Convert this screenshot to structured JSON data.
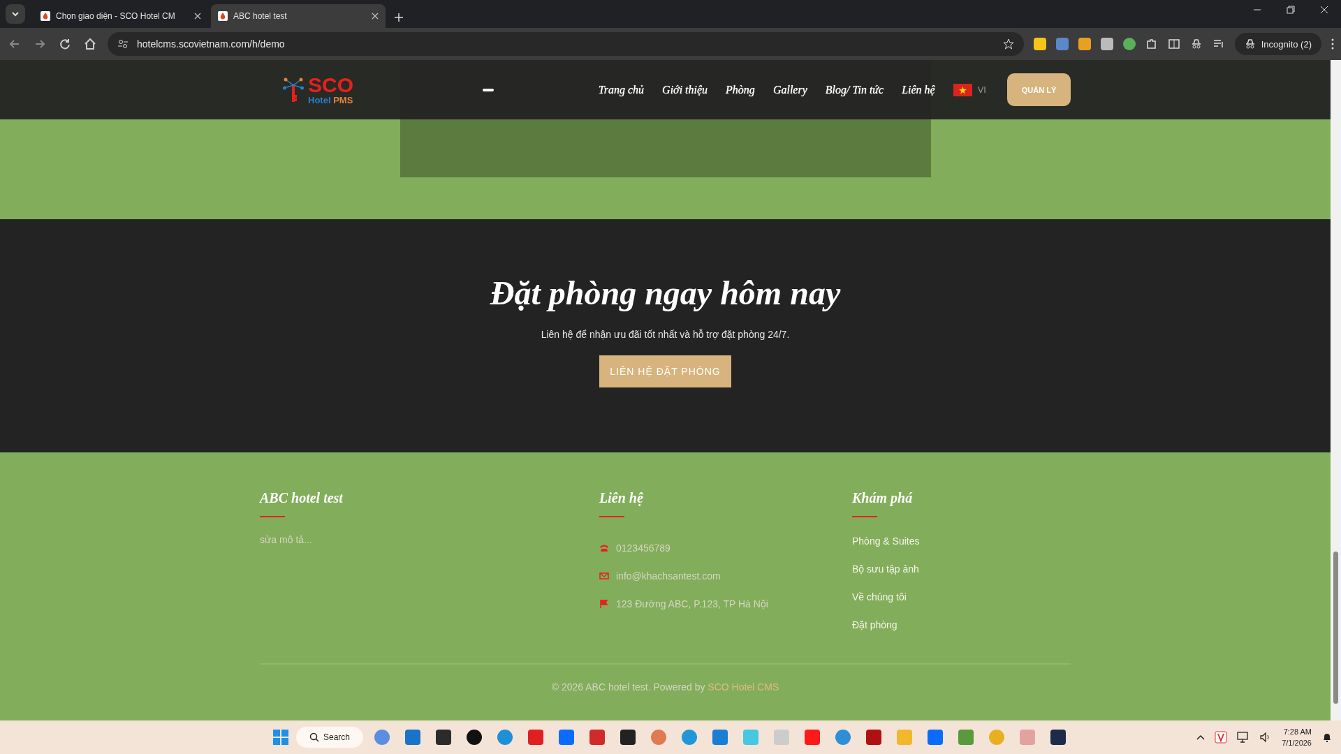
{
  "browser": {
    "tabs": [
      {
        "title": "Chọn giao diện - SCO Hotel CM",
        "selected": false
      },
      {
        "title": "ABC hotel test",
        "selected": true
      }
    ],
    "url": "hotelcms.scovietnam.com/h/demo",
    "profile": "Incognito (2)"
  },
  "header": {
    "logo": {
      "name": "SCO",
      "sub_a": "Hotel",
      "sub_b": "PMS"
    },
    "nav": [
      "Trang chủ",
      "Giới thiệu",
      "Phòng",
      "Gallery",
      "Blog/ Tin tức",
      "Liên hệ"
    ],
    "language": "VI",
    "admin_button": "QUẢN LÝ"
  },
  "cta": {
    "title": "Đặt phòng ngay hôm nay",
    "text": "Liên hệ để nhận ưu đãi tốt nhất và hỗ trợ đặt phòng 24/7.",
    "button": "LIÊN HỆ ĐẶT PHÒNG"
  },
  "footer": {
    "about": {
      "title": "ABC hotel test",
      "text": "sửa mô tả..."
    },
    "contact": {
      "title": "Liên hệ",
      "items": [
        {
          "kind": "phone",
          "text": "0123456789"
        },
        {
          "kind": "email",
          "text": "info@khachsantest.com"
        },
        {
          "kind": "address",
          "text": "123 Đường ABC, P.123, TP Hà Nội"
        }
      ]
    },
    "explore": {
      "title": "Khám phá",
      "links": [
        "Phòng & Suites",
        "Bộ sưu tập ảnh",
        "Về chúng tôi",
        "Đặt phòng"
      ]
    },
    "copyright": "© 2026 ABC hotel test. Powered by ",
    "copyright_link": "SCO Hotel CMS"
  },
  "taskbar": {
    "search": "Search",
    "time": "7:28 AM",
    "date": "7/1/2026"
  }
}
